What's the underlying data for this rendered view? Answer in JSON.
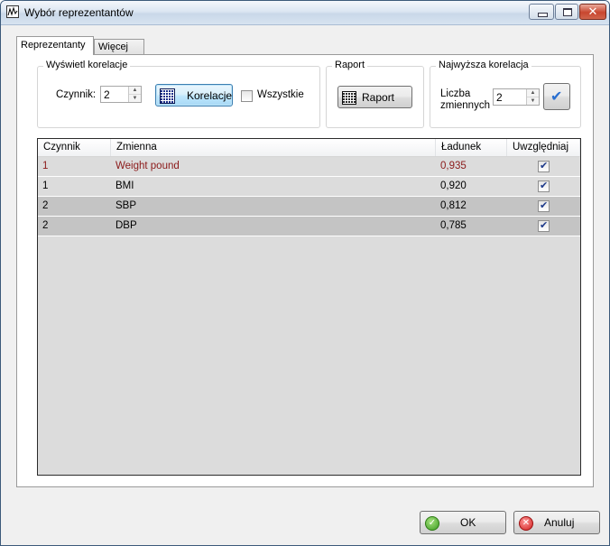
{
  "window": {
    "title": "Wybór reprezentantów"
  },
  "tabs": [
    {
      "label": "Reprezentanty",
      "active": true
    },
    {
      "label": "Więcej",
      "active": false
    }
  ],
  "group_show": {
    "title": "Wyświetl korelacje",
    "factor_label": "Czynnik:",
    "factor_value": "2",
    "correlations_button": "Korelacje",
    "all_label": "Wszystkie",
    "all_checked": false
  },
  "group_report": {
    "title": "Raport",
    "report_button": "Raport"
  },
  "group_highest": {
    "title": "Najwyższa korelacja",
    "count_label_1": "Liczba",
    "count_label_2": "zmiennych",
    "count_value": "2"
  },
  "table": {
    "columns": [
      "Czynnik",
      "Zmienna",
      "Ładunek",
      "Uwzględniaj"
    ],
    "rows": [
      {
        "factor": "1",
        "variable": "Weight pound",
        "loading": "0,935",
        "include": true
      },
      {
        "factor": "1",
        "variable": "BMI",
        "loading": "0,920",
        "include": true
      },
      {
        "factor": "2",
        "variable": "SBP",
        "loading": "0,812",
        "include": true
      },
      {
        "factor": "2",
        "variable": "DBP",
        "loading": "0,785",
        "include": true
      }
    ]
  },
  "footer": {
    "ok_label": "OK",
    "cancel_label": "Anuluj"
  },
  "colors": {
    "highlight_text": "#8b1a1a",
    "row_dark": "#c4c4c4",
    "row_light": "#dcdcdc"
  }
}
